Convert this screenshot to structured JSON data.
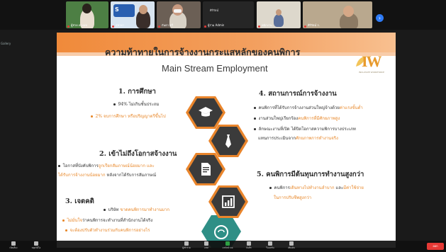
{
  "meeting": {
    "side_label": "Gallery",
    "participants": [
      {
        "name": "ผู้ช่วย ดวงแข"
      },
      {
        "name": "สุชาดา"
      },
      {
        "name": "กันตา ทวี"
      },
      {
        "name": "ผู้ร่วม Admin"
      },
      {
        "name": "พนักงาน"
      },
      {
        "name": "ศิริรัตน์ ร."
      }
    ],
    "leave_label": "ออก",
    "toolbar": [
      {
        "label": "เปิดเสียง",
        "icon": "mic-icon"
      },
      {
        "label": "หยุดวิดีโอ",
        "icon": "camera-icon"
      },
      {
        "label": "ผู้เข้าร่วม",
        "icon": "participants-icon"
      },
      {
        "label": "แชท",
        "icon": "chat-icon"
      },
      {
        "label": "แชร์หน้าจอ",
        "icon": "share-icon"
      },
      {
        "label": "บันทึก",
        "icon": "record-icon"
      },
      {
        "label": "รีแอคชัน",
        "icon": "reaction-icon"
      },
      {
        "label": "เพิ่มเติม",
        "icon": "more-icon"
      }
    ],
    "accent": "#2e7bf6"
  },
  "slide": {
    "title_th": "ความท้าทายในการจ้างงานกระแสหลักของคนพิการ",
    "title_en": "Main Stream Employment",
    "logo_text": "IW",
    "logo_sub": "INCLUSIVE WORKFORCE",
    "accent": "#e8882b",
    "sections": [
      {
        "title": "1. การศึกษา",
        "bullets": [
          {
            "text": "94% ไม่เกินชั้นประถม",
            "highlight": ""
          },
          {
            "text": "2% จบการศึกษา หรือปริญญาตรีขึ้นไป",
            "highlight": "all"
          }
        ],
        "icon": "graduation-cap-icon"
      },
      {
        "title": "2. เข้าไม่ถึงโอกาสจ้างงาน",
        "bullets": [
          {
            "pre": "โอกาสที่บังคับพิการ",
            "hl": "ถูกเรียกสัมภาษณ์น้อยมาก และ",
            "post": ""
          },
          {
            "pre": "",
            "hl": "ได้รับการจ้างงานน้อยมาก",
            "post": " หลังจากได้รับการสัมภาษณ์"
          }
        ],
        "icon": "resume-icon"
      },
      {
        "title": "3. เจตคติ",
        "bullets": [
          {
            "pre": "บริษัท ",
            "hl": "ขาดคนพิการมาทำงานมาก",
            "post": ""
          },
          {
            "pre": "",
            "hl": "ไม่มั่นใจ",
            "post": "ว่าคนพิการจะทำงานที่สำนักงานได้จริง"
          },
          {
            "pre": "",
            "hl": "จะต้องปรับตัวทำงานร่วมกับคนพิการอย่างไร",
            "post": ""
          }
        ],
        "icon": "brain-icon"
      },
      {
        "title": "4. สถานการณ์การจ้างงาน",
        "bullets": [
          {
            "pre": "คนพิการที่ได้รับการจ้างงานส่วนใหญ่จ้างด้วย",
            "hl": "ค่าแรงขั้นต่ำ",
            "post": ""
          },
          {
            "pre": "งานส่วนใหญ่เรียกร้อง",
            "hl": "คนพิการที่มีศักยภาพสูง",
            "post": ""
          },
          {
            "pre": "ลักษณะงานที่เปิด ได้ปิดโอกาสความพิการบางประเภท",
            "hl": "",
            "post": ""
          },
          {
            "pre": "แทนการประเมินจาก",
            "hl": "ศักยภาพการทำงานจริง",
            "post": ""
          }
        ],
        "icon": "tie-icon"
      },
      {
        "title": "5. คนพิการมีต้นทุนการทำงานสูงกว่า",
        "bullets": [
          {
            "pre": "คนพิการ",
            "hl": "เดินทางไปทำงานลำบาก",
            "post": " และ",
            "hl2": "มีค่าใช้จ่าย"
          },
          {
            "pre": "",
            "hl": "ในการปรับชีพสูงกว่า",
            "post": ""
          }
        ],
        "icon": "chart-icon"
      }
    ]
  }
}
